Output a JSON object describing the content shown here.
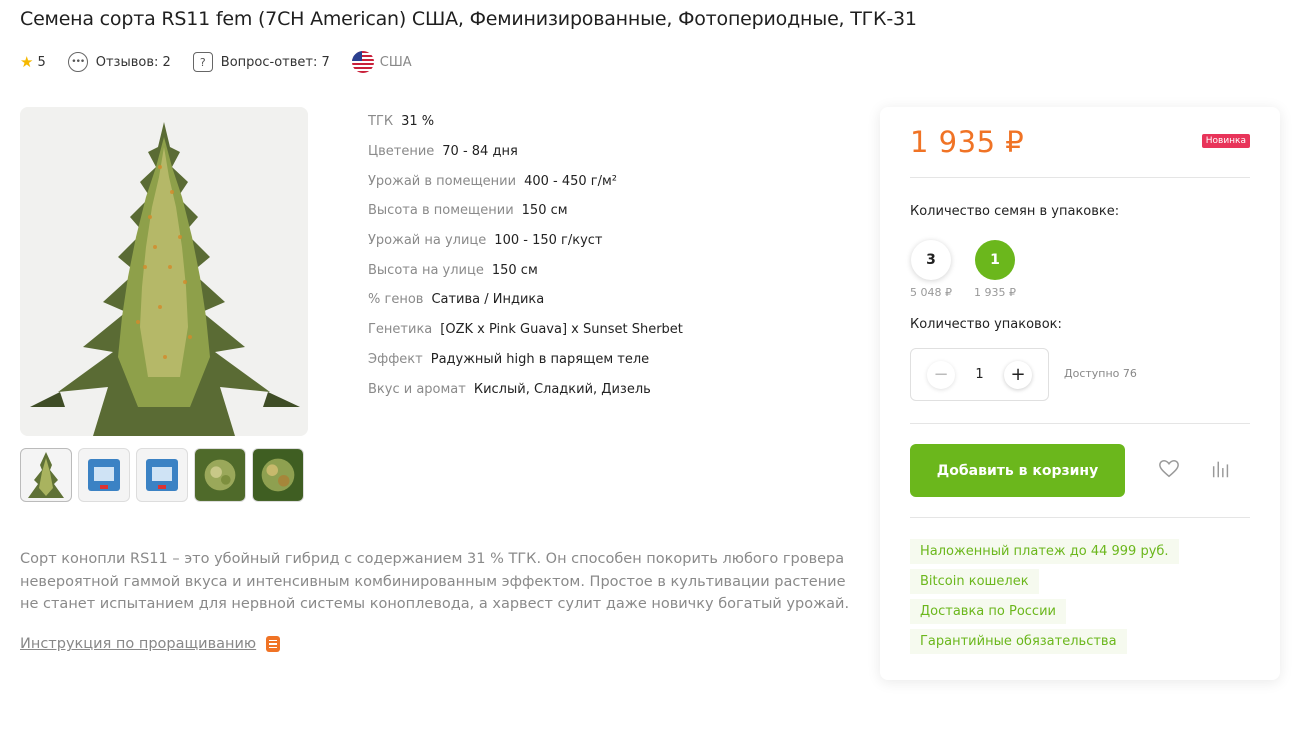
{
  "product": {
    "title": "Семена сорта RS11 fem (7CH American) США, Феминизированные, Фотопериодные, ТГК-31"
  },
  "meta": {
    "rating": "5",
    "reviews_label": "Отзывов: 2",
    "qa_label": "Вопрос-ответ: 7",
    "country": "США"
  },
  "specs": [
    {
      "label": "ТГК",
      "value": "31 %"
    },
    {
      "label": "Цветение",
      "value": "70 - 84 дня"
    },
    {
      "label": "Урожай в помещении",
      "value": "400 - 450 г/м²"
    },
    {
      "label": "Высота в помещении",
      "value": "150 см"
    },
    {
      "label": "Урожай на улице",
      "value": "100 - 150 г/куст"
    },
    {
      "label": "Высота на улице",
      "value": "150 см"
    },
    {
      "label": "% генов",
      "value": "Сатива / Индика"
    },
    {
      "label": "Генетика",
      "value": "[OZK x Pink Guava] x Sunset Sherbet"
    },
    {
      "label": "Эффект",
      "value": "Радужный high в парящем теле"
    },
    {
      "label": "Вкус и аромат",
      "value": "Кислый, Сладкий, Дизель"
    }
  ],
  "description": "Сорт конопли RS11 – это убойный гибрид с содержанием 31 % ТГК. Он способен покорить любого гровера невероятной гаммой вкуса и интенсивным комбинированным эффектом. Простое в культивации растение не станет испытанием для нервной системы коноплевода, а харвест сулит даже новичку богатый урожай.",
  "instruction_link": "Инструкция по проращиванию",
  "buy": {
    "price": "1 935 ₽",
    "badge": "Новинка",
    "seeds_label": "Количество семян в упаковке:",
    "packs": [
      {
        "count": "3",
        "price": "5 048 ₽",
        "selected": false
      },
      {
        "count": "1",
        "price": "1 935 ₽",
        "selected": true
      }
    ],
    "qty_label": "Количество упаковок:",
    "qty_value": "1",
    "available": "Доступно 76",
    "add_to_cart": "Добавить в корзину",
    "features": [
      "Наложенный платеж до 44 999 руб.",
      "Bitcoin кошелек",
      "Доставка по России",
      "Гарантийные обязательства"
    ]
  },
  "colors": {
    "accent_green": "#6bb71c",
    "price_orange": "#f07325",
    "badge_pink": "#e8345a"
  }
}
